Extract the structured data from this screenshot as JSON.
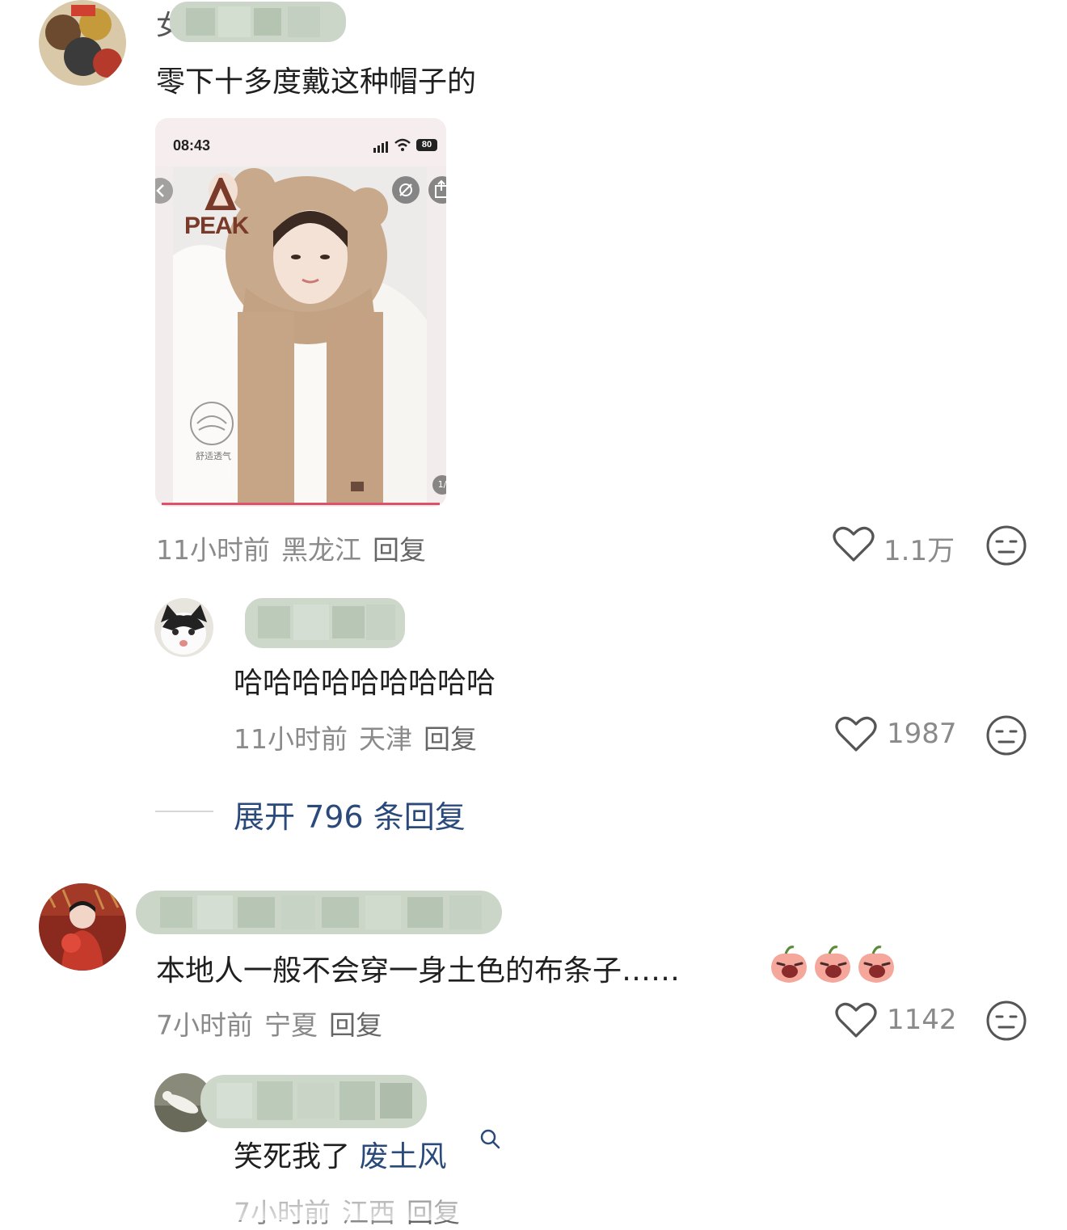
{
  "comments": [
    {
      "username": "女",
      "text": "零下十多度戴这种帽子的",
      "time": "11小时前",
      "location": "黑龙江",
      "reply_label": "回复",
      "likes": "1.1万",
      "image": {
        "status_time": "08:43",
        "battery": "80",
        "brand": "PEAK",
        "badge_text": "舒适透气",
        "page_indicator": "1/"
      }
    },
    {
      "username": "",
      "text": "本地人一般不会穿一身土色的布条子……",
      "time": "7小时前",
      "location": "宁夏",
      "reply_label": "回复",
      "likes": "1142"
    }
  ],
  "replies": [
    {
      "username": "",
      "text": "哈哈哈哈哈哈哈哈哈",
      "time": "11小时前",
      "location": "天津",
      "reply_label": "回复",
      "likes": "1987"
    },
    {
      "username": "",
      "text_prefix": "笑死我了",
      "text_link": "废土风",
      "time": "7小时前",
      "location": "江西",
      "reply_label": "回复"
    }
  ],
  "expand_replies": "展开 796 条回复",
  "icons": {
    "like": "heart-outline-icon",
    "dislike": "neutral-face-icon",
    "search": "search-icon",
    "emoji": "crying-peach-emoji"
  },
  "colors": {
    "link": "#2a4a7b",
    "meta": "#8a8a8a",
    "blur": "#c9d6c6"
  }
}
